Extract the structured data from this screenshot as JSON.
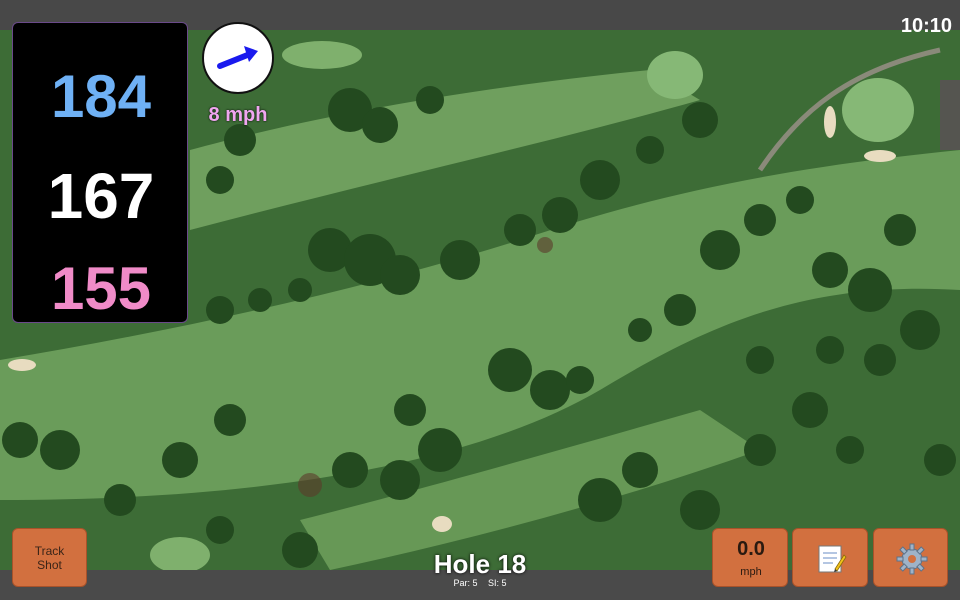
{
  "status_bar": {
    "time": "10:10"
  },
  "distances": {
    "back": "184",
    "middle": "167",
    "front": "155"
  },
  "wind": {
    "speed_label": "8 mph",
    "arrow_icon": "wind-arrow-icon",
    "arrow_color": "#1a1aee"
  },
  "hole": {
    "title": "Hole 18",
    "par_label": "Par: 5",
    "si_label": "SI: 5"
  },
  "buttons": {
    "track_shot_line1": "Track",
    "track_shot_line2": "Shot",
    "speed_value": "0.0",
    "speed_unit": "mph",
    "notes_icon": "notepad-icon",
    "settings_icon": "gear-icon"
  },
  "colors": {
    "back_distance": "#6fb1f5",
    "middle_distance": "#ffffff",
    "front_distance": "#f08bc8",
    "button_accent": "#d2703f",
    "wind_label": "#f0a6f0"
  }
}
